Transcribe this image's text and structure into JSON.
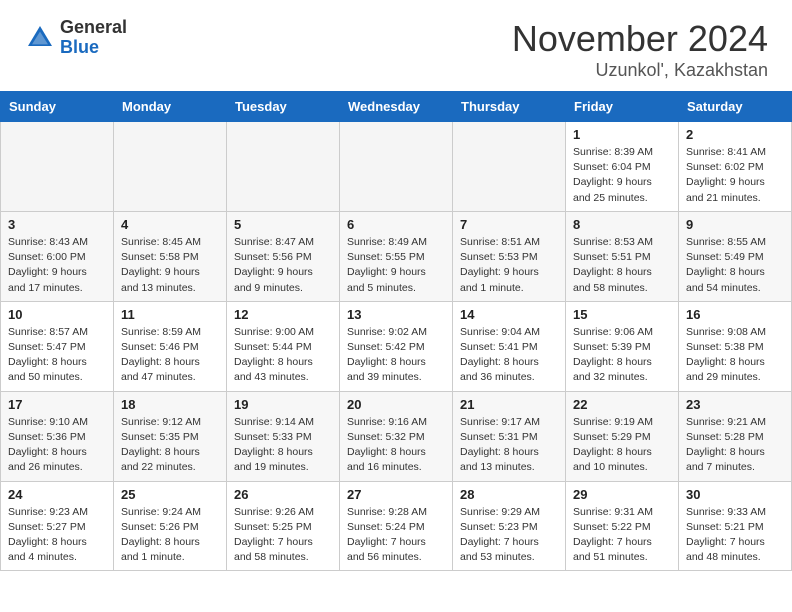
{
  "logo": {
    "general": "General",
    "blue": "Blue"
  },
  "title": "November 2024",
  "location": "Uzunkol', Kazakhstan",
  "days_of_week": [
    "Sunday",
    "Monday",
    "Tuesday",
    "Wednesday",
    "Thursday",
    "Friday",
    "Saturday"
  ],
  "weeks": [
    {
      "days": [
        {
          "num": "",
          "info": ""
        },
        {
          "num": "",
          "info": ""
        },
        {
          "num": "",
          "info": ""
        },
        {
          "num": "",
          "info": ""
        },
        {
          "num": "",
          "info": ""
        },
        {
          "num": "1",
          "info": "Sunrise: 8:39 AM\nSunset: 6:04 PM\nDaylight: 9 hours\nand 25 minutes."
        },
        {
          "num": "2",
          "info": "Sunrise: 8:41 AM\nSunset: 6:02 PM\nDaylight: 9 hours\nand 21 minutes."
        }
      ]
    },
    {
      "days": [
        {
          "num": "3",
          "info": "Sunrise: 8:43 AM\nSunset: 6:00 PM\nDaylight: 9 hours\nand 17 minutes."
        },
        {
          "num": "4",
          "info": "Sunrise: 8:45 AM\nSunset: 5:58 PM\nDaylight: 9 hours\nand 13 minutes."
        },
        {
          "num": "5",
          "info": "Sunrise: 8:47 AM\nSunset: 5:56 PM\nDaylight: 9 hours\nand 9 minutes."
        },
        {
          "num": "6",
          "info": "Sunrise: 8:49 AM\nSunset: 5:55 PM\nDaylight: 9 hours\nand 5 minutes."
        },
        {
          "num": "7",
          "info": "Sunrise: 8:51 AM\nSunset: 5:53 PM\nDaylight: 9 hours\nand 1 minute."
        },
        {
          "num": "8",
          "info": "Sunrise: 8:53 AM\nSunset: 5:51 PM\nDaylight: 8 hours\nand 58 minutes."
        },
        {
          "num": "9",
          "info": "Sunrise: 8:55 AM\nSunset: 5:49 PM\nDaylight: 8 hours\nand 54 minutes."
        }
      ]
    },
    {
      "days": [
        {
          "num": "10",
          "info": "Sunrise: 8:57 AM\nSunset: 5:47 PM\nDaylight: 8 hours\nand 50 minutes."
        },
        {
          "num": "11",
          "info": "Sunrise: 8:59 AM\nSunset: 5:46 PM\nDaylight: 8 hours\nand 47 minutes."
        },
        {
          "num": "12",
          "info": "Sunrise: 9:00 AM\nSunset: 5:44 PM\nDaylight: 8 hours\nand 43 minutes."
        },
        {
          "num": "13",
          "info": "Sunrise: 9:02 AM\nSunset: 5:42 PM\nDaylight: 8 hours\nand 39 minutes."
        },
        {
          "num": "14",
          "info": "Sunrise: 9:04 AM\nSunset: 5:41 PM\nDaylight: 8 hours\nand 36 minutes."
        },
        {
          "num": "15",
          "info": "Sunrise: 9:06 AM\nSunset: 5:39 PM\nDaylight: 8 hours\nand 32 minutes."
        },
        {
          "num": "16",
          "info": "Sunrise: 9:08 AM\nSunset: 5:38 PM\nDaylight: 8 hours\nand 29 minutes."
        }
      ]
    },
    {
      "days": [
        {
          "num": "17",
          "info": "Sunrise: 9:10 AM\nSunset: 5:36 PM\nDaylight: 8 hours\nand 26 minutes."
        },
        {
          "num": "18",
          "info": "Sunrise: 9:12 AM\nSunset: 5:35 PM\nDaylight: 8 hours\nand 22 minutes."
        },
        {
          "num": "19",
          "info": "Sunrise: 9:14 AM\nSunset: 5:33 PM\nDaylight: 8 hours\nand 19 minutes."
        },
        {
          "num": "20",
          "info": "Sunrise: 9:16 AM\nSunset: 5:32 PM\nDaylight: 8 hours\nand 16 minutes."
        },
        {
          "num": "21",
          "info": "Sunrise: 9:17 AM\nSunset: 5:31 PM\nDaylight: 8 hours\nand 13 minutes."
        },
        {
          "num": "22",
          "info": "Sunrise: 9:19 AM\nSunset: 5:29 PM\nDaylight: 8 hours\nand 10 minutes."
        },
        {
          "num": "23",
          "info": "Sunrise: 9:21 AM\nSunset: 5:28 PM\nDaylight: 8 hours\nand 7 minutes."
        }
      ]
    },
    {
      "days": [
        {
          "num": "24",
          "info": "Sunrise: 9:23 AM\nSunset: 5:27 PM\nDaylight: 8 hours\nand 4 minutes."
        },
        {
          "num": "25",
          "info": "Sunrise: 9:24 AM\nSunset: 5:26 PM\nDaylight: 8 hours\nand 1 minute."
        },
        {
          "num": "26",
          "info": "Sunrise: 9:26 AM\nSunset: 5:25 PM\nDaylight: 7 hours\nand 58 minutes."
        },
        {
          "num": "27",
          "info": "Sunrise: 9:28 AM\nSunset: 5:24 PM\nDaylight: 7 hours\nand 56 minutes."
        },
        {
          "num": "28",
          "info": "Sunrise: 9:29 AM\nSunset: 5:23 PM\nDaylight: 7 hours\nand 53 minutes."
        },
        {
          "num": "29",
          "info": "Sunrise: 9:31 AM\nSunset: 5:22 PM\nDaylight: 7 hours\nand 51 minutes."
        },
        {
          "num": "30",
          "info": "Sunrise: 9:33 AM\nSunset: 5:21 PM\nDaylight: 7 hours\nand 48 minutes."
        }
      ]
    }
  ]
}
